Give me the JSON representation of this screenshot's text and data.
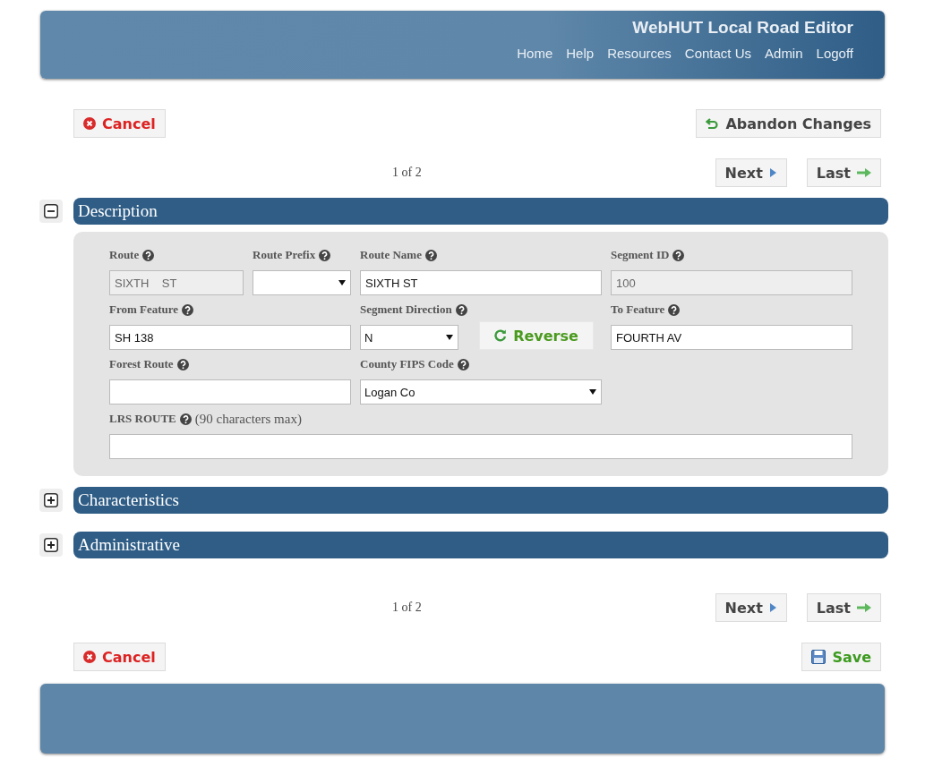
{
  "header": {
    "title": "WebHUT Local Road Editor",
    "nav": [
      "Home",
      "Help",
      "Resources",
      "Contact Us",
      "Admin",
      "Logoff"
    ]
  },
  "top_actions": {
    "cancel": "Cancel",
    "secondary": {
      "kind": "abandon",
      "label": "Abandon Changes"
    }
  },
  "pager_top": {
    "count": "1 of 2",
    "next": "Next",
    "last": "Last"
  },
  "sections": [
    {
      "title": "Description",
      "expanded": true,
      "fields": [
        {
          "kind": "text",
          "label": "Route",
          "value": "SIXTH    ST",
          "disabled": true
        },
        {
          "kind": "select",
          "label": "Route Prefix"
        },
        {
          "kind": "text",
          "label": "Route Name",
          "value": "SIXTH ST",
          "disabled": false
        },
        {
          "kind": "text",
          "label": "Segment ID",
          "value": "100",
          "disabled": true
        },
        {
          "kind": "text",
          "label": "From Feature",
          "value": "SH 138",
          "disabled": false
        },
        {
          "kind": "select",
          "label": "Segment Direction",
          "value": "N"
        },
        {
          "kind": "button",
          "label": "Reverse"
        },
        {
          "kind": "text",
          "label": "To Feature",
          "value": "FOURTH AV",
          "disabled": false
        },
        {
          "kind": "text",
          "label": "Forest Route",
          "disabled": false
        },
        {
          "kind": "select",
          "label": "County FIPS Code",
          "value": "Logan Co"
        },
        {
          "kind": "text",
          "label": "LRS ROUTE",
          "note": "(90 characters max)",
          "disabled": false
        }
      ]
    },
    {
      "title": "Characteristics",
      "expanded": false
    },
    {
      "title": "Administrative",
      "expanded": false
    }
  ],
  "pager_bottom": {
    "count": "1 of 2",
    "next": "Next",
    "last": "Last"
  },
  "bottom_actions": {
    "cancel": "Cancel",
    "secondary": {
      "kind": "save",
      "label": "Save"
    }
  }
}
